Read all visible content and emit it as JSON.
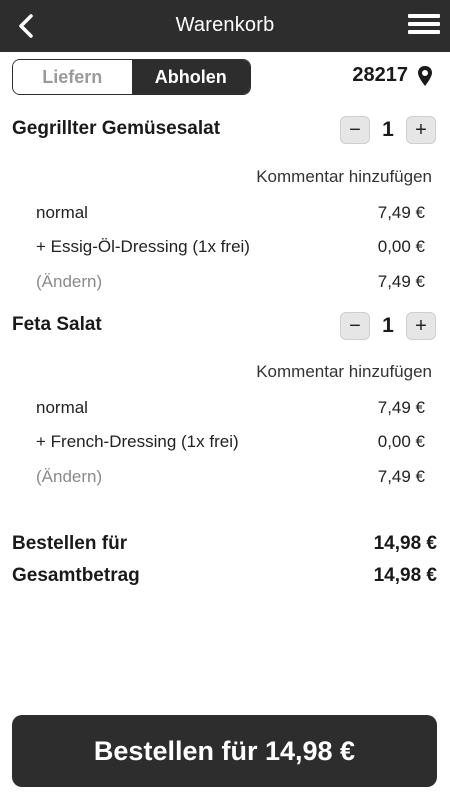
{
  "header": {
    "title": "Warenkorb",
    "back_icon": "chevron-left-icon",
    "menu_icon": "hamburger-menu-icon"
  },
  "mode_toggle": {
    "options": [
      "Liefern",
      "Abholen"
    ],
    "selected": "Abholen"
  },
  "location": {
    "zip": "28217",
    "icon": "location-pin-icon"
  },
  "items": [
    {
      "name": "Gegrillter Gemüsesalat",
      "quantity": "1",
      "minus": "−",
      "plus": "+",
      "comment_link": "Kommentar hinzufügen",
      "lines": [
        {
          "label": "normal",
          "price": "7,49 €"
        },
        {
          "label": "+ Essig-Öl-Dressing (1x frei)",
          "price": "0,00 €"
        },
        {
          "label": "(Ändern)",
          "price": "7,49 €"
        }
      ]
    },
    {
      "name": "Feta Salat",
      "quantity": "1",
      "minus": "−",
      "plus": "+",
      "comment_link": "Kommentar hinzufügen",
      "lines": [
        {
          "label": "normal",
          "price": "7,49 €"
        },
        {
          "label": "+ French-Dressing (1x frei)",
          "price": "0,00 €"
        },
        {
          "label": "(Ändern)",
          "price": "7,49 €"
        }
      ]
    }
  ],
  "totals": {
    "order_for_label": "Bestellen für",
    "order_for_value": "14,98 €",
    "total_label": "Gesamtbetrag",
    "total_value": "14,98 €"
  },
  "cta": {
    "label": "Bestellen für 14,98 €"
  },
  "colors": {
    "dark": "#2d2d2d",
    "muted": "#8a8a8a",
    "qty_button": "#e6e6e6"
  }
}
